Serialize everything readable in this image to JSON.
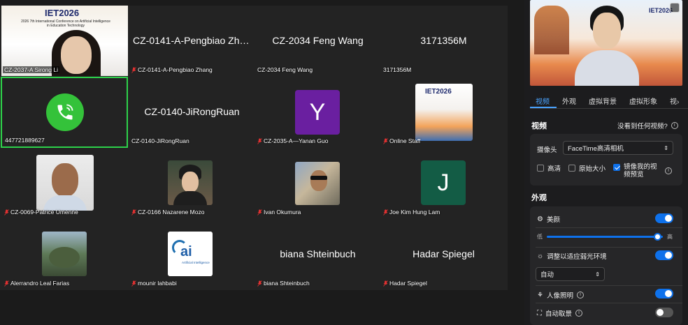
{
  "gallery": {
    "tiles": [
      {
        "label": "CZ-2037-A Sirong Li",
        "bigname": ""
      },
      {
        "label": "CZ-0141-A-Pengbiao Zhang",
        "bigname": "CZ-0141-A-Pengbiao Zha..."
      },
      {
        "label": "CZ-2034 Feng Wang",
        "bigname": "CZ-2034 Feng Wang"
      },
      {
        "label": "3171356M",
        "bigname": "3171356M"
      },
      {
        "label": "447721889627",
        "bigname": ""
      },
      {
        "label": "CZ-0140-JiRongRuan",
        "bigname": "CZ-0140-JiRongRuan"
      },
      {
        "label": "CZ-2035-A—Yanan Guo",
        "bigname": "",
        "letter": "Y"
      },
      {
        "label": "Online Staff",
        "bigname": ""
      },
      {
        "label": "CZ-0069-Patrice Umenne",
        "bigname": ""
      },
      {
        "label": "CZ-0166 Nazarene Mozo",
        "bigname": ""
      },
      {
        "label": "Ivan Okumura",
        "bigname": ""
      },
      {
        "label": "Joe Kim Hung Lam",
        "bigname": "",
        "letter": "J"
      },
      {
        "label": "Alerrandro Leal Farias",
        "bigname": ""
      },
      {
        "label": "mounir lahbabi",
        "bigname": ""
      },
      {
        "label": "biana Shteinbuch",
        "bigname": "biana Shteinbuch"
      },
      {
        "label": "Hadar Spiegel",
        "bigname": "Hadar Spiegel"
      }
    ],
    "poster_text": "IET2026",
    "poster_sub": "2026 7th International Conference on Artificial Intelligence in Education Technology",
    "ai_logo_text": "ai",
    "ai_logo_sub": "Artificial Intelligence"
  },
  "panel": {
    "selfview_badge": "IET2026",
    "tabs": [
      "视频",
      "外观",
      "虚拟背景",
      "虚拟形象",
      "视"
    ],
    "video": {
      "title": "视频",
      "help_link": "没看到任何视频?",
      "camera_label": "摄像头",
      "camera_value": "FaceTime高清相机",
      "opt_hd": "高清",
      "opt_original": "原始大小",
      "opt_mirror_1": "镜像我的视",
      "opt_mirror_2": "频预览"
    },
    "appearance": {
      "title": "外观",
      "beauty": "美颜",
      "slider_low": "低",
      "slider_high": "高",
      "slider_value": 0.95,
      "lowlight": "调整以适应弱光环境",
      "lowlight_mode": "自动",
      "portrait_light": "人像照明",
      "auto_frame": "自动取景"
    }
  },
  "colors": {
    "accent": "#0e71eb",
    "active_speaker": "#2dd24a",
    "avatar_Y": "#6a1fa0",
    "avatar_J": "#135c45"
  }
}
